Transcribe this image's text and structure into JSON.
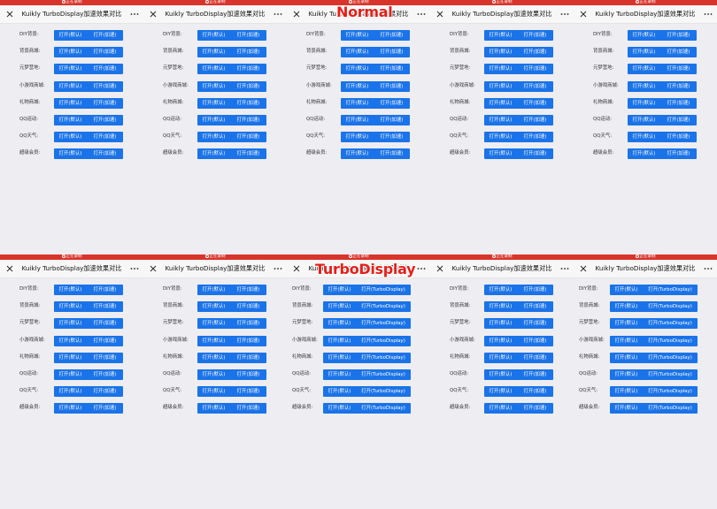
{
  "status_bar": {
    "recording_label": "正在录制"
  },
  "nav": {
    "title": "Kuikly TurboDisplay加速效果对比"
  },
  "watermarks": {
    "normal": "Normal",
    "turbo": "TurboDisplay"
  },
  "rows": [
    {
      "label": "DIY背景:"
    },
    {
      "label": "背景商城:"
    },
    {
      "label": "元梦营地:"
    },
    {
      "label": "小游戏商城:"
    },
    {
      "label": "礼物商城:"
    },
    {
      "label": "QQ运动:"
    },
    {
      "label": "QQ天气:"
    },
    {
      "label": "超级会员:"
    }
  ],
  "buttons": {
    "default_label": "打开(默认)",
    "accelerate_label": "打开(加速)",
    "turbo_label": "打开(TurboDisplay)"
  },
  "panels": {
    "top": [
      "accelerate",
      "accelerate",
      "accelerate",
      "accelerate",
      "accelerate"
    ],
    "bottom": [
      "accelerate",
      "accelerate",
      "turbo",
      "accelerate",
      "turbo"
    ]
  },
  "colors": {
    "status_bar": "#d9342b",
    "button": "#1a73e8",
    "watermark": "#e3201b",
    "background": "#ededf2"
  }
}
